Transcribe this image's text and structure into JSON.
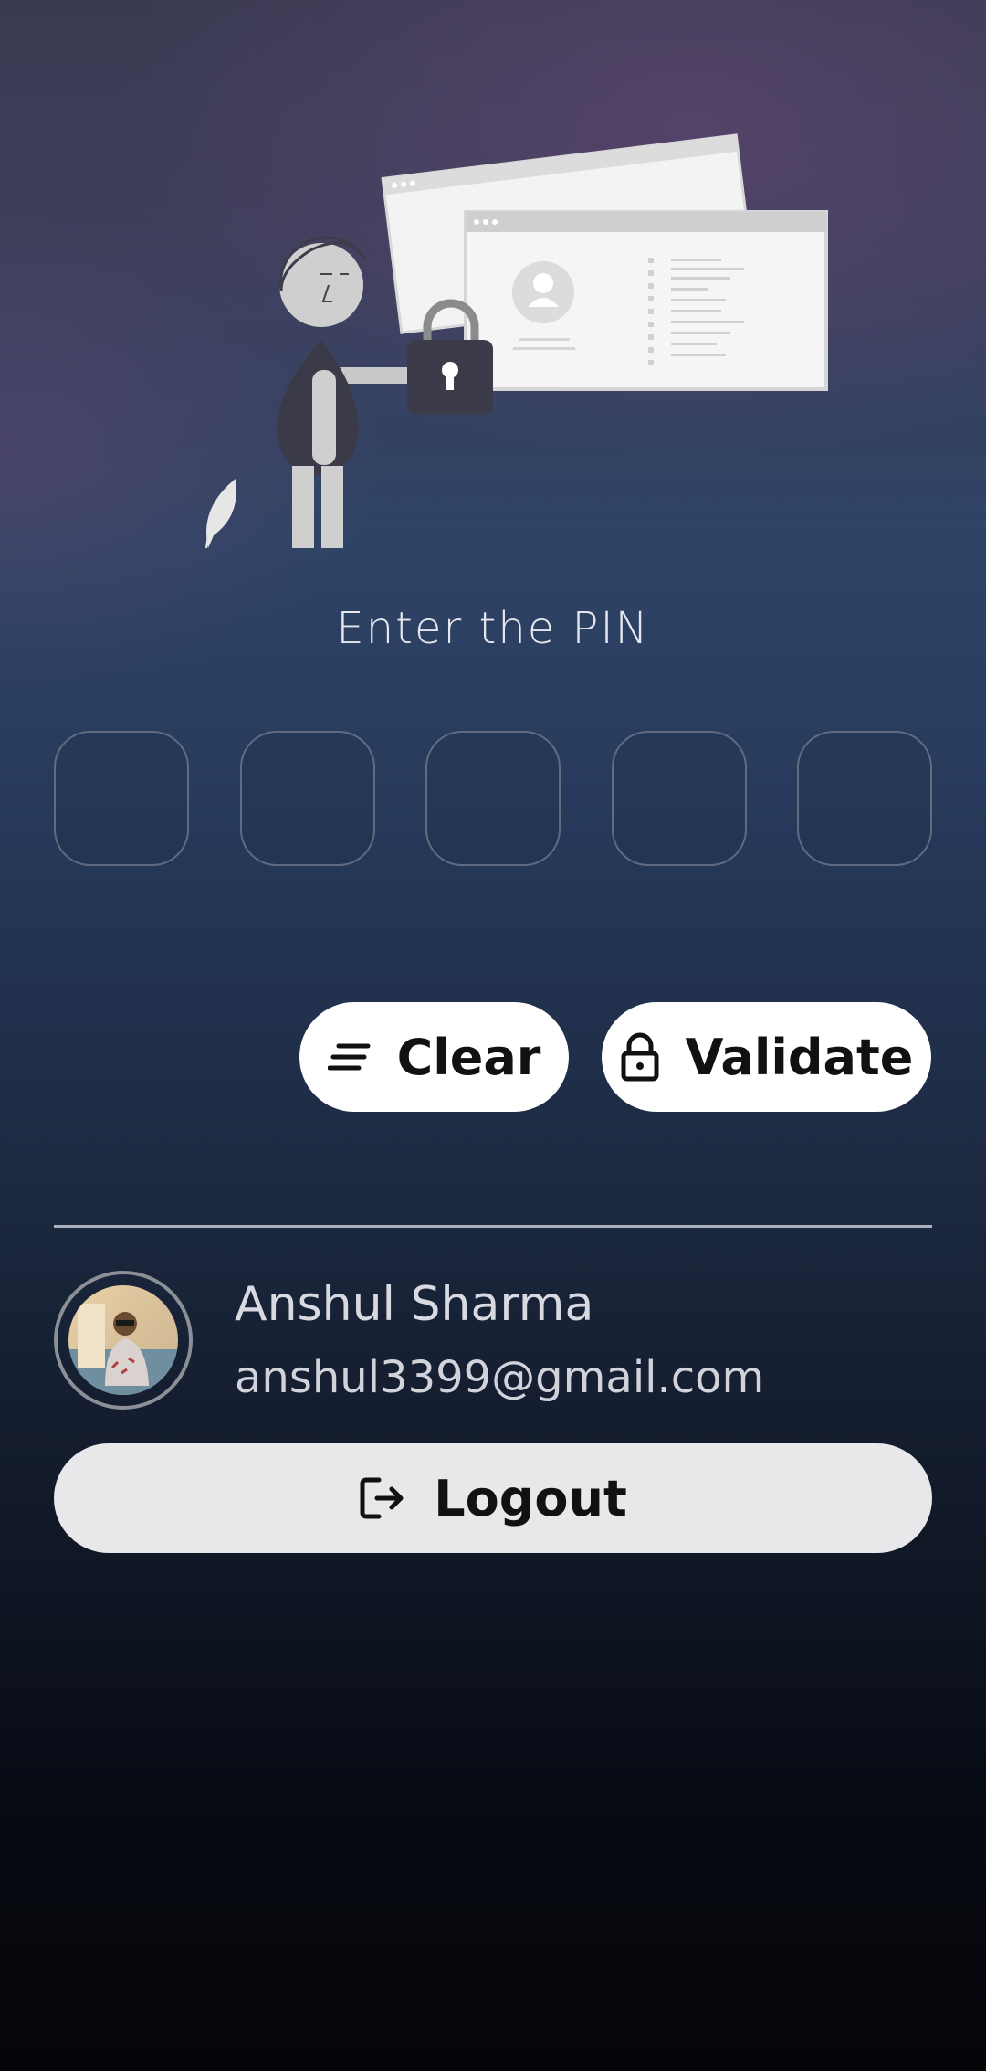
{
  "pin": {
    "title": "Enter the PIN",
    "box_count": 5
  },
  "actions": {
    "clear_label": "Clear",
    "validate_label": "Validate",
    "clear_icon": "clear-lines-icon",
    "validate_icon": "lock-icon"
  },
  "user": {
    "name": "Anshul Sharma",
    "email": "anshul3399@gmail.com"
  },
  "logout": {
    "label": "Logout",
    "icon": "logout-icon"
  },
  "colors": {
    "button_bg": "#ffffff",
    "logout_bg": "#e8e8ea",
    "text_light": "#d9d9e2"
  }
}
